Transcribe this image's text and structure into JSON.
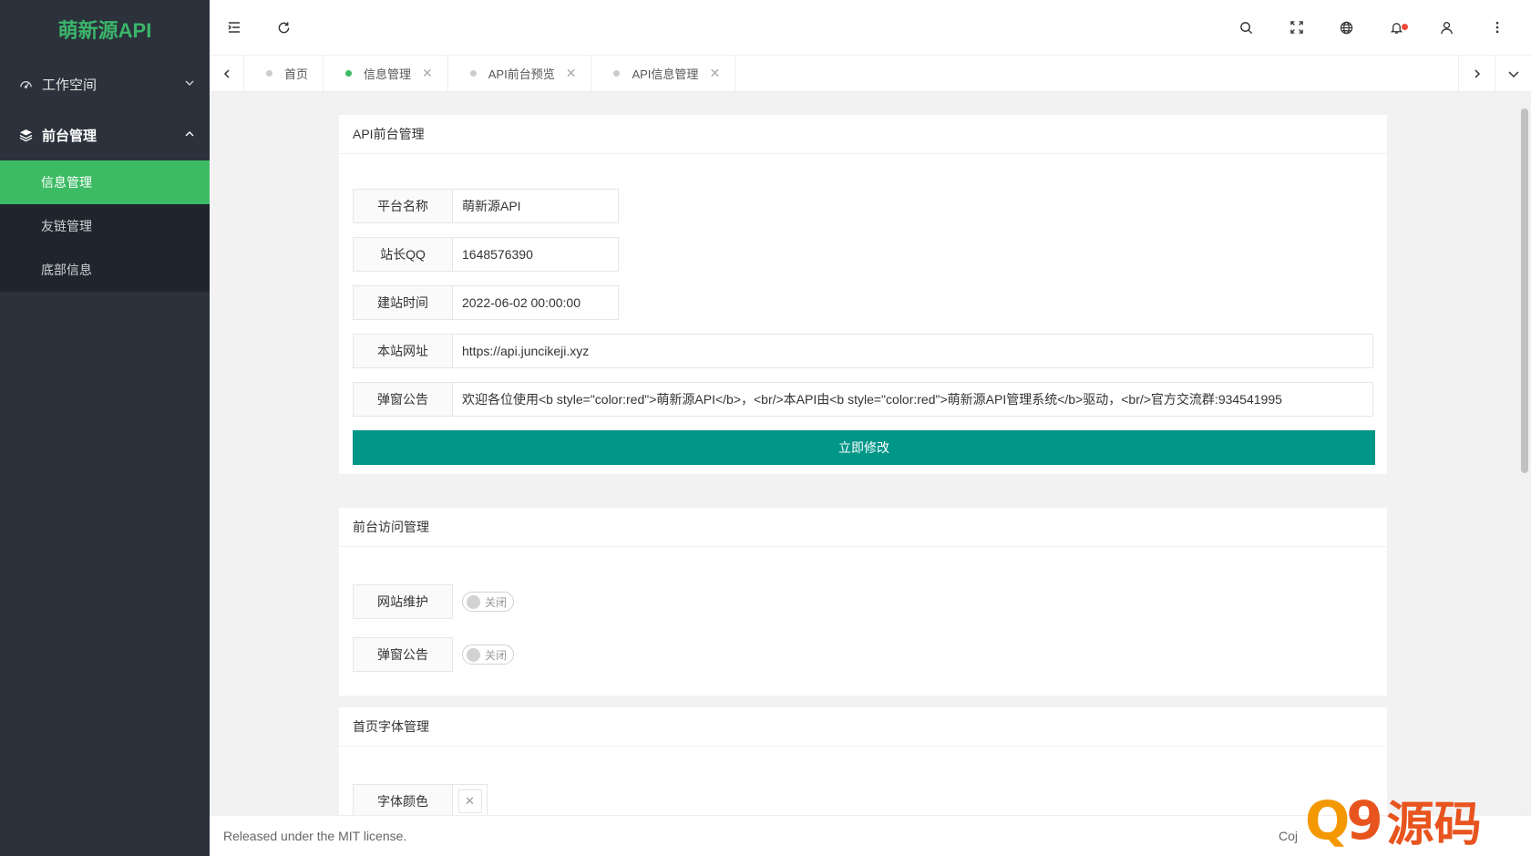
{
  "sidebar": {
    "logo": "萌新源API",
    "groups": [
      {
        "label": "工作空间",
        "icon": "dashboard-icon",
        "open": false
      },
      {
        "label": "前台管理",
        "icon": "layers-icon",
        "open": true,
        "items": [
          {
            "label": "信息管理",
            "active": true
          },
          {
            "label": "友链管理",
            "active": false
          },
          {
            "label": "底部信息",
            "active": false
          }
        ]
      }
    ]
  },
  "header": {
    "left_icons": [
      "menu-fold-icon",
      "refresh-icon"
    ],
    "right_icons": [
      "search-icon",
      "fullscreen-icon",
      "globe-icon",
      "bell-icon",
      "user-icon",
      "more-icon"
    ]
  },
  "tabs": [
    {
      "label": "首页",
      "closable": false,
      "active": false
    },
    {
      "label": "信息管理",
      "closable": true,
      "active": true
    },
    {
      "label": "API前台预览",
      "closable": true,
      "active": false
    },
    {
      "label": "API信息管理",
      "closable": true,
      "active": false
    }
  ],
  "api_card": {
    "title": "API前台管理",
    "fields": {
      "platform_name": {
        "label": "平台名称",
        "value": "萌新源API"
      },
      "owner_qq": {
        "label": "站长QQ",
        "value": "1648576390"
      },
      "build_time": {
        "label": "建站时间",
        "value": "2022-06-02 00:00:00"
      },
      "site_url": {
        "label": "本站网址",
        "value": "https://api.juncikeji.xyz"
      },
      "popup_notice": {
        "label": "弹窗公告",
        "value": "欢迎各位使用<b style=\"color:red\">萌新源API</b>，<br/>本API由<b style=\"color:red\">萌新源API管理系统</b>驱动，<br/>官方交流群:934541995"
      }
    },
    "submit_label": "立即修改"
  },
  "access_card": {
    "title": "前台访问管理",
    "maintenance": {
      "label": "网站维护",
      "state": "关闭"
    },
    "popup": {
      "label": "弹窗公告",
      "state": "关闭"
    }
  },
  "font_card": {
    "title": "首页字体管理",
    "font_color": {
      "label": "字体颜色",
      "icon": "close-icon"
    }
  },
  "footer": {
    "license": "Released under the MIT license.",
    "copyright_partial": "Coj"
  },
  "watermark": {
    "text_q": "Q",
    "text_9": "9",
    "text_cn": "源码"
  },
  "colors": {
    "sidebar_bg": "#2b323b",
    "accent_green": "#3dbb64",
    "primary_button": "#009688"
  }
}
